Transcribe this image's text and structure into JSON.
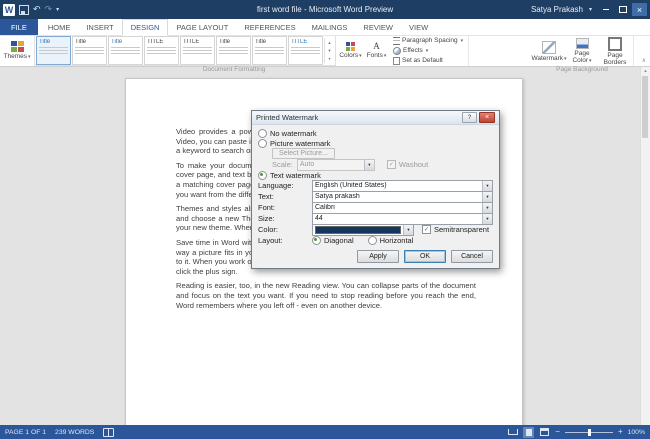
{
  "titlebar": {
    "title": "first word file - Microsoft Word Preview",
    "user": "Satya Prakash"
  },
  "ribbon": {
    "tabs": [
      {
        "label": "FILE"
      },
      {
        "label": "HOME"
      },
      {
        "label": "INSERT"
      },
      {
        "label": "DESIGN"
      },
      {
        "label": "PAGE LAYOUT"
      },
      {
        "label": "REFERENCES"
      },
      {
        "label": "MAILINGS"
      },
      {
        "label": "REVIEW"
      },
      {
        "label": "VIEW"
      }
    ],
    "themes_label": "Themes",
    "gallery": {
      "items": [
        "Title",
        "Title",
        "Title",
        "TITLE",
        "TITLE",
        "Title",
        "Title",
        "TITLE"
      ]
    },
    "colors_label": "Colors",
    "fonts_label": "Fonts",
    "paragraph_spacing_label": "Paragraph Spacing",
    "effects_label": "Effects",
    "set_default_label": "Set as Default",
    "watermark_label": "Watermark",
    "page_color_label": "Page Color",
    "page_borders_label": "Page Borders",
    "group_document_formatting": "Document Formatting",
    "group_page_background": "Page Background"
  },
  "document": {
    "paragraphs": [
      "Video provides a powerful way to help you prove your point. When you click Online Video, you can paste in the embed code for the video you want to add. You can also type a keyword to search online for the video that best fits your document.",
      "To make your document look professionally produced, Word provides header, footer, cover page, and text box designs that complement each other. For example, you can add a matching cover page, header, and sidebar. Click Insert and then choose the elements you want from the different galleries.",
      "Themes and styles also help keep your document coordinated. When you click Design and choose a new Theme, the pictures, charts, and SmartArt graphics change to match your new theme. When you apply styles, your headings change to match the new theme.",
      "Save time in Word with new buttons that show up where you need them. To change the way a picture fits in your document, click it and a button for layout options appears next to it. When you work on a table, click where you want to add a row or a column, and then click the plus sign.",
      "Reading is easier, too, in the new Reading view. You can collapse parts of the document and focus on the text you want. If you need to stop reading before you reach the end, Word remembers where you left off - even on another device."
    ]
  },
  "dialog": {
    "title": "Printed Watermark",
    "options": {
      "no_watermark": "No watermark",
      "picture_watermark": "Picture watermark",
      "text_watermark": "Text watermark"
    },
    "select_picture_label": "Select Picture...",
    "scale_label": "Scale:",
    "scale_value": "Auto",
    "washout_label": "Washout",
    "fields": [
      {
        "label": "Language:",
        "value": "English (United States)"
      },
      {
        "label": "Text:",
        "value": "Satya prakash"
      },
      {
        "label": "Font:",
        "value": "Calibri"
      },
      {
        "label": "Size:",
        "value": "44"
      },
      {
        "label": "Color:",
        "value": ""
      }
    ],
    "color_hex": "#17365d",
    "color_style": "background:#17365d",
    "semitransparent_label": "Semitransparent",
    "layout_label": "Layout:",
    "layout_options": [
      "Diagonal",
      "Horizontal"
    ],
    "buttons": [
      "Apply",
      "OK",
      "Cancel"
    ]
  },
  "statusbar": {
    "page": "PAGE 1 OF 1",
    "words": "239 WORDS",
    "zoom": "100%"
  },
  "colors": {
    "titlebar": "#1f3e63",
    "accent": "#2b579a",
    "statusbar": "#2b579a",
    "watermark_color_swatch": "#17365d"
  }
}
